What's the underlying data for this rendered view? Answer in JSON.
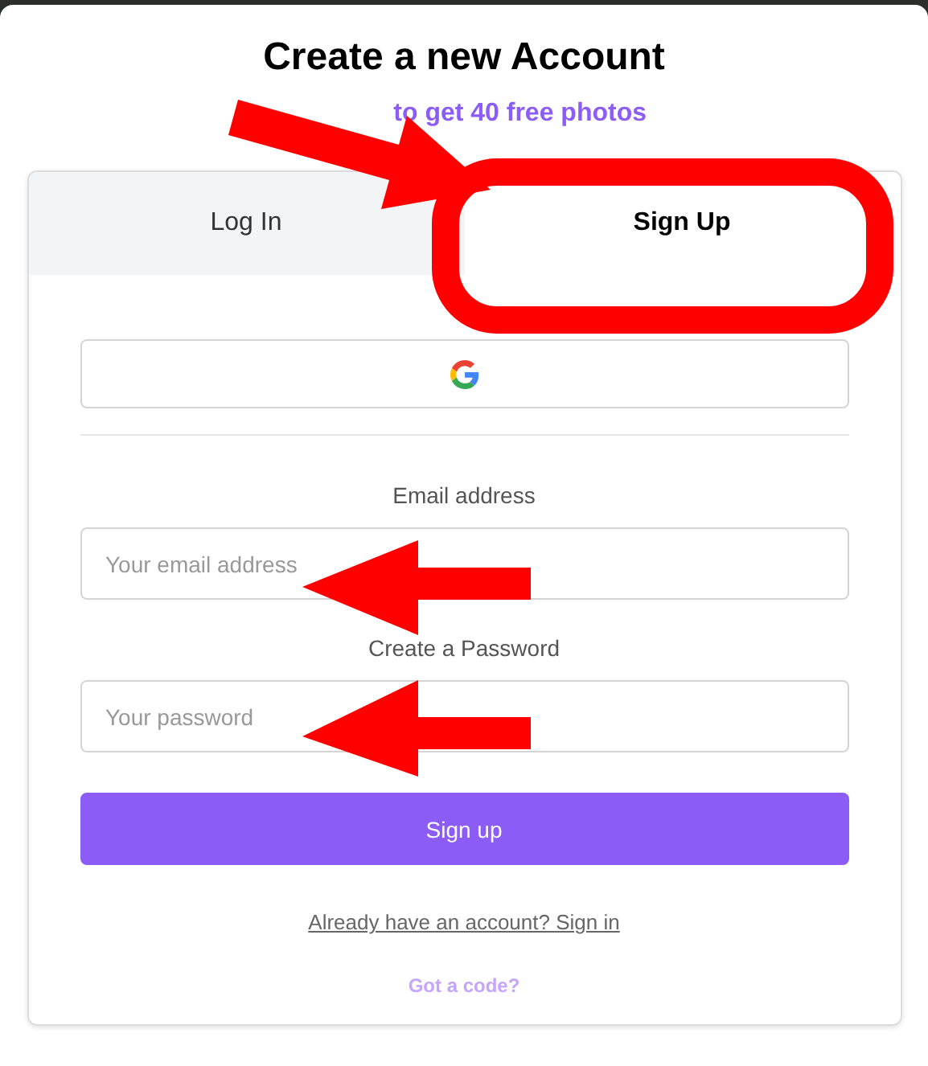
{
  "title": "Create a new Account",
  "subtitle": "to get 40 free photos",
  "tabs": [
    {
      "label": "Log In",
      "selected": false
    },
    {
      "label": "Sign Up",
      "selected": true
    }
  ],
  "fields": [
    {
      "label": "Email address",
      "placeholder": "Your email address"
    },
    {
      "label": "Create a Password",
      "placeholder": "Your password"
    }
  ],
  "submit": "Sign up",
  "signin_link": "Already have an account? Sign in",
  "code_link": "Got a code?"
}
